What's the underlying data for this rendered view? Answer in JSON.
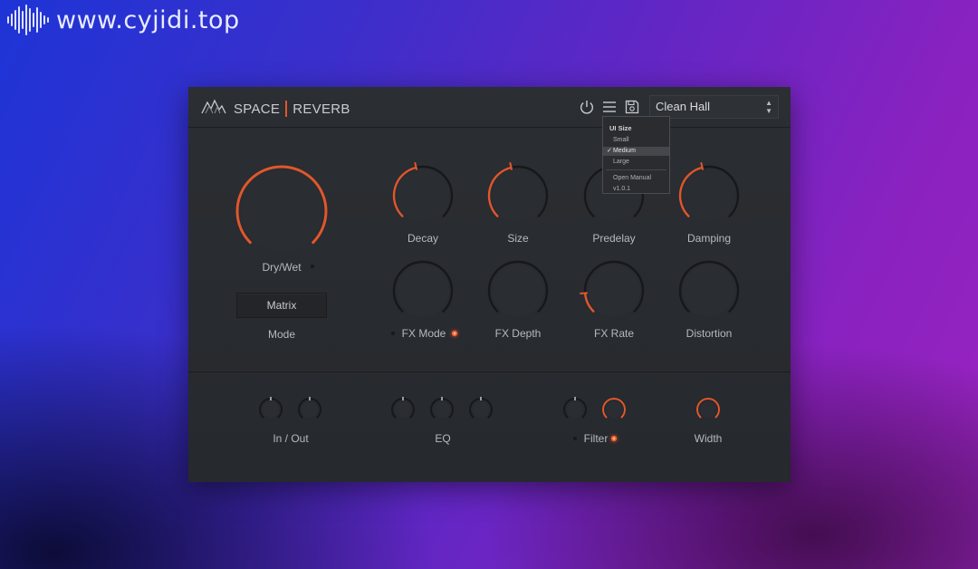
{
  "watermark": {
    "text": "www.cyjidi.top"
  },
  "plugin": {
    "brand_left": "SPACE",
    "brand_right": "REVERB",
    "accent_color": "#e0572d",
    "preset": {
      "value": "Clean Hall"
    }
  },
  "menu": {
    "header": "UI Size",
    "items": [
      "Small",
      "Medium",
      "Large"
    ],
    "selected": "Medium",
    "check": "✓",
    "manual": "Open Manual",
    "version": "v1.0.1"
  },
  "controls": {
    "dry_wet": {
      "label": "Dry/Wet",
      "value": 1.0
    },
    "mode": {
      "label": "Mode",
      "value": "Matrix"
    },
    "decay": {
      "label": "Decay",
      "value": 0.45
    },
    "size": {
      "label": "Size",
      "value": 0.45
    },
    "predelay": {
      "label": "Predelay",
      "value": 0.0
    },
    "damping": {
      "label": "Damping",
      "value": 0.45
    },
    "fx_mode": {
      "label": "FX Mode",
      "value": 0.0
    },
    "fx_depth": {
      "label": "FX Depth",
      "value": 0.0
    },
    "fx_rate": {
      "label": "FX Rate",
      "value": 0.15
    },
    "distortion": {
      "label": "Distortion",
      "value": 0.0
    },
    "in_out": {
      "label": "In / Out"
    },
    "eq": {
      "label": "EQ"
    },
    "filter": {
      "label": "Filter"
    },
    "width": {
      "label": "Width",
      "value": 1.0
    }
  }
}
